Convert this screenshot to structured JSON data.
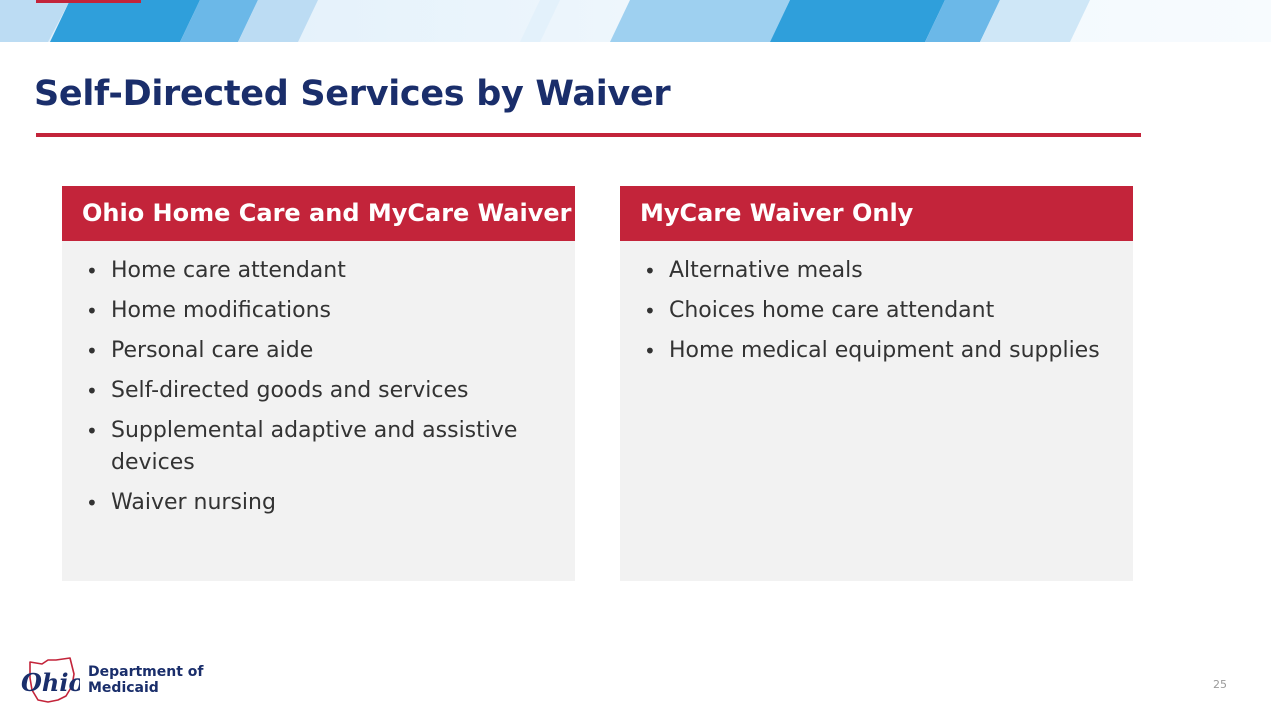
{
  "slide": {
    "title": "Self-Directed Services by Waiver",
    "page_number": "25"
  },
  "panels": [
    {
      "header": "Ohio Home Care and MyCare Waiver",
      "items": [
        "Home care attendant",
        "Home modifications",
        "Personal care aide",
        "Self-directed goods and services",
        "Supplemental adaptive and assistive devices",
        "Waiver nursing"
      ]
    },
    {
      "header": "MyCare Waiver Only",
      "items": [
        "Alternative meals",
        "Choices home care attendant",
        "Home medical equipment and supplies"
      ]
    }
  ],
  "footer": {
    "logo_word": "Ohio",
    "department_line1": "Department of",
    "department_line2": "Medicaid"
  },
  "colors": {
    "title_blue": "#1a2e6b",
    "accent_red": "#c3243a",
    "panel_bg": "#f2f2f2",
    "banner_blue": "#2f9fdb",
    "banner_light": "#cfe7f7"
  }
}
